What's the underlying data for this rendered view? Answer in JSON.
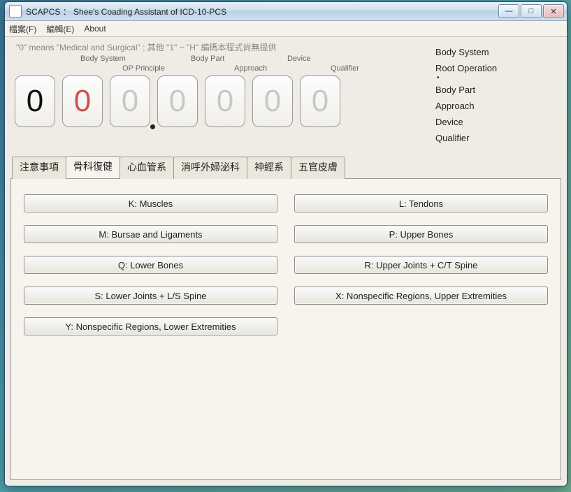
{
  "window": {
    "title": "SCAPCS ： Shee's Coading Assistant of ICD-10-PCS"
  },
  "menu": {
    "file": "檔案(F)",
    "edit": "編輯(E)",
    "about": "About"
  },
  "header": {
    "hint": "\"0\" means \"Medical and Surgical\" ;  其他 \"1\" ~ \"H\" 編碼本程式尚無提供"
  },
  "slots": {
    "labels": {
      "body_system": "Body System",
      "op_principle": "OP Principle",
      "body_part": "Body Part",
      "approach": "Approach",
      "device": "Device",
      "qualifier": "Qualifier"
    },
    "values": [
      "0",
      "0",
      "0",
      "0",
      "0",
      "0",
      "0"
    ]
  },
  "rightnav": [
    "Body System",
    "Root Operation",
    "Body Part",
    "Approach",
    "Device",
    "Qualifier"
  ],
  "tabs": [
    "注意事項",
    "骨科復健",
    "心血管系",
    "消呼外婦泌科",
    "神經系",
    "五官皮膚"
  ],
  "options": [
    "K: Muscles",
    "L: Tendons",
    "M: Bursae and Ligaments",
    "P: Upper Bones",
    "Q: Lower Bones",
    "R: Upper Joints + C/T Spine",
    "S: Lower Joints + L/S Spine",
    "X: Nonspecific Regions, Upper Extremities",
    "Y: Nonspecific Regions, Lower Extremities"
  ]
}
